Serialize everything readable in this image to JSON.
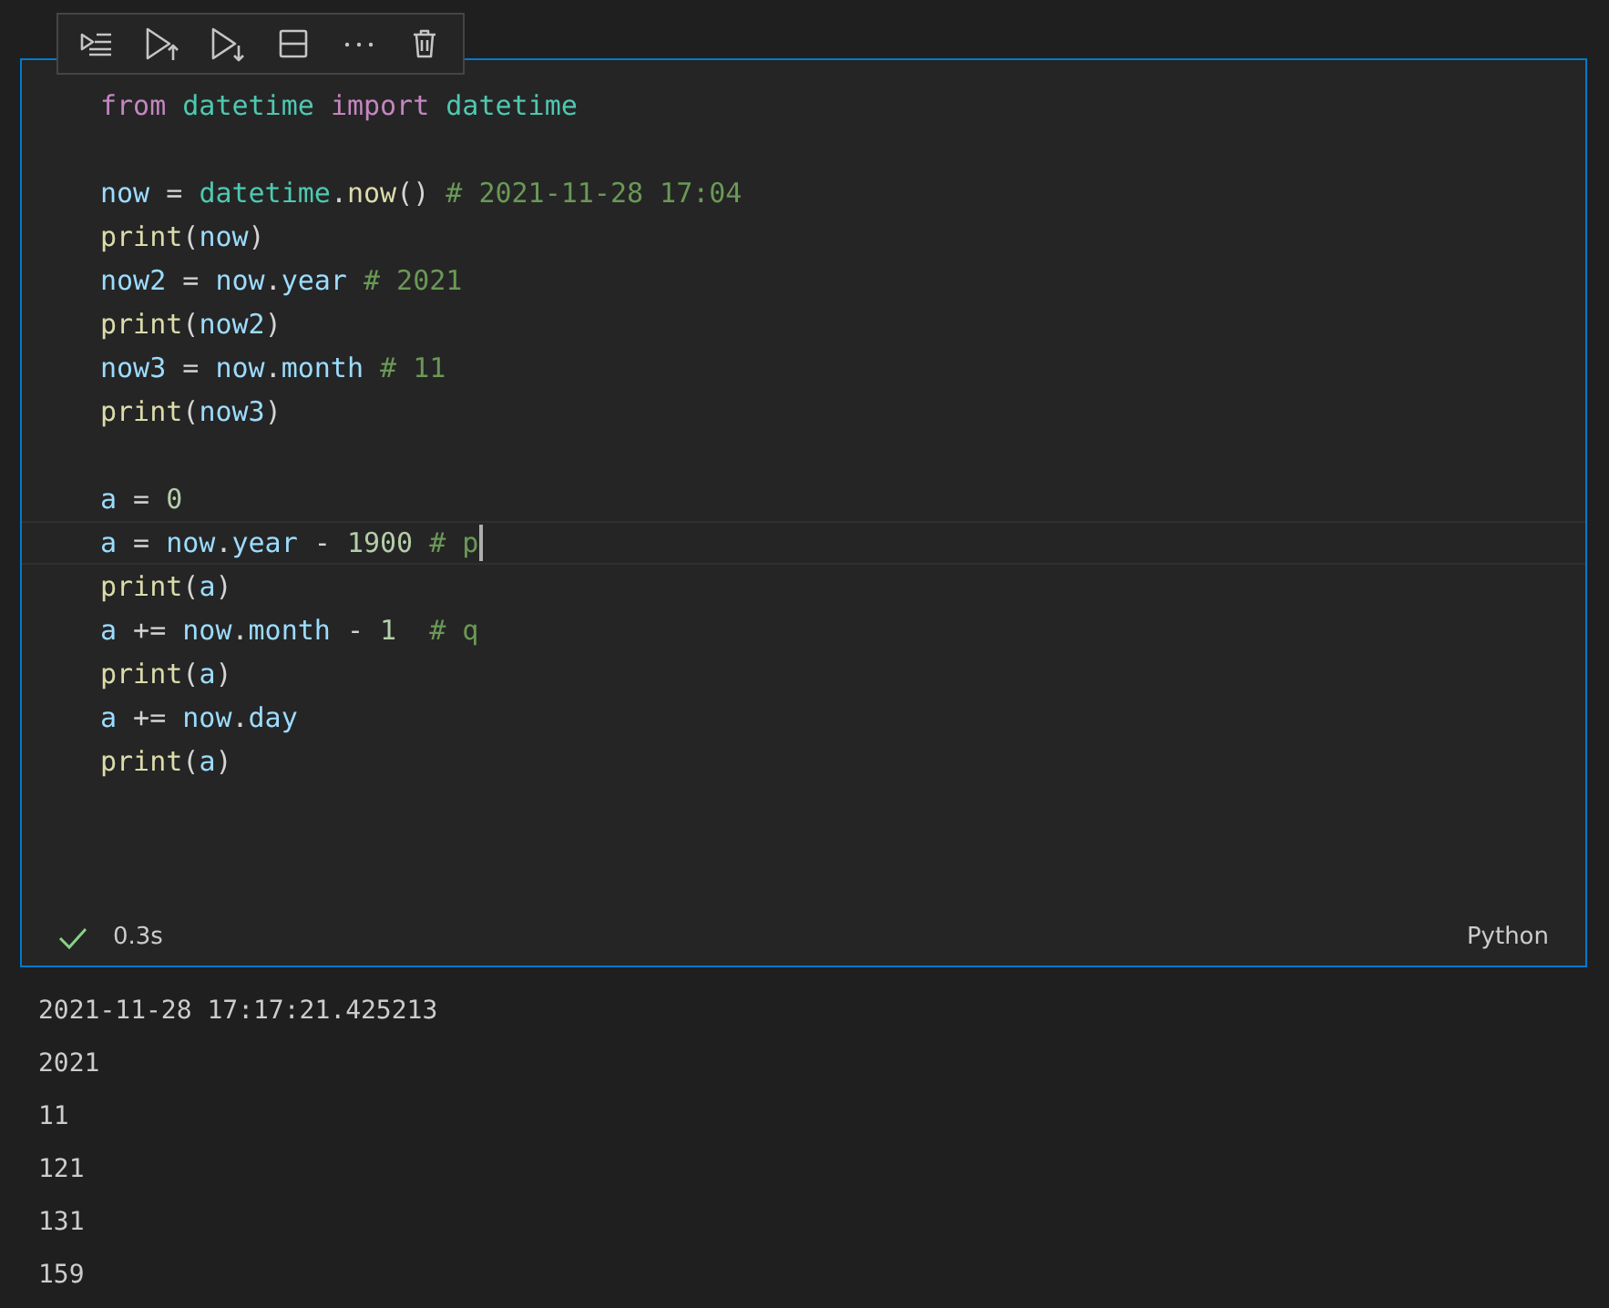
{
  "toolbar": {
    "buttons": [
      {
        "kind": "run-by-line"
      },
      {
        "kind": "run-above"
      },
      {
        "kind": "run-below"
      },
      {
        "kind": "split"
      },
      {
        "kind": "more"
      },
      {
        "kind": "delete"
      }
    ]
  },
  "cell": {
    "lines": [
      {
        "kind": "code",
        "current": false,
        "tokens": [
          {
            "text": "from ",
            "kind": "keyword"
          },
          {
            "text": "datetime ",
            "kind": "class"
          },
          {
            "text": "import ",
            "kind": "keyword"
          },
          {
            "text": "datetime",
            "kind": "class"
          }
        ]
      },
      {
        "kind": "blank"
      },
      {
        "kind": "code",
        "current": false,
        "tokens": [
          {
            "text": "now",
            "kind": "variable"
          },
          {
            "text": " = ",
            "kind": "operator"
          },
          {
            "text": "datetime",
            "kind": "class"
          },
          {
            "text": ".",
            "kind": "operator"
          },
          {
            "text": "now",
            "kind": "function"
          },
          {
            "text": "() ",
            "kind": "operator"
          },
          {
            "text": "# 2021-11-28 17:04",
            "kind": "comment"
          }
        ]
      },
      {
        "kind": "code",
        "current": false,
        "tokens": [
          {
            "text": "print",
            "kind": "function"
          },
          {
            "text": "(",
            "kind": "operator"
          },
          {
            "text": "now",
            "kind": "variable"
          },
          {
            "text": ")",
            "kind": "operator"
          }
        ]
      },
      {
        "kind": "code",
        "current": false,
        "tokens": [
          {
            "text": "now2",
            "kind": "variable"
          },
          {
            "text": " = ",
            "kind": "operator"
          },
          {
            "text": "now",
            "kind": "variable"
          },
          {
            "text": ".",
            "kind": "operator"
          },
          {
            "text": "year ",
            "kind": "variable"
          },
          {
            "text": "# 2021",
            "kind": "comment"
          }
        ]
      },
      {
        "kind": "code",
        "current": false,
        "tokens": [
          {
            "text": "print",
            "kind": "function"
          },
          {
            "text": "(",
            "kind": "operator"
          },
          {
            "text": "now2",
            "kind": "variable"
          },
          {
            "text": ")",
            "kind": "operator"
          }
        ]
      },
      {
        "kind": "code",
        "current": false,
        "tokens": [
          {
            "text": "now3",
            "kind": "variable"
          },
          {
            "text": " = ",
            "kind": "operator"
          },
          {
            "text": "now",
            "kind": "variable"
          },
          {
            "text": ".",
            "kind": "operator"
          },
          {
            "text": "month ",
            "kind": "variable"
          },
          {
            "text": "# 11",
            "kind": "comment"
          }
        ]
      },
      {
        "kind": "code",
        "current": false,
        "tokens": [
          {
            "text": "print",
            "kind": "function"
          },
          {
            "text": "(",
            "kind": "operator"
          },
          {
            "text": "now3",
            "kind": "variable"
          },
          {
            "text": ")",
            "kind": "operator"
          }
        ]
      },
      {
        "kind": "blank"
      },
      {
        "kind": "code",
        "current": false,
        "tokens": [
          {
            "text": "a",
            "kind": "variable"
          },
          {
            "text": " = ",
            "kind": "operator"
          },
          {
            "text": "0",
            "kind": "number"
          }
        ]
      },
      {
        "kind": "code",
        "current": true,
        "tokens": [
          {
            "text": "a",
            "kind": "variable"
          },
          {
            "text": " = ",
            "kind": "operator"
          },
          {
            "text": "now",
            "kind": "variable"
          },
          {
            "text": ".",
            "kind": "operator"
          },
          {
            "text": "year",
            "kind": "variable"
          },
          {
            "text": " - ",
            "kind": "operator"
          },
          {
            "text": "1900 ",
            "kind": "number"
          },
          {
            "text": "# p",
            "kind": "comment"
          }
        ]
      },
      {
        "kind": "code",
        "current": false,
        "tokens": [
          {
            "text": "print",
            "kind": "function"
          },
          {
            "text": "(",
            "kind": "operator"
          },
          {
            "text": "a",
            "kind": "variable"
          },
          {
            "text": ")",
            "kind": "operator"
          }
        ]
      },
      {
        "kind": "code",
        "current": false,
        "tokens": [
          {
            "text": "a",
            "kind": "variable"
          },
          {
            "text": " += ",
            "kind": "operator"
          },
          {
            "text": "now",
            "kind": "variable"
          },
          {
            "text": ".",
            "kind": "operator"
          },
          {
            "text": "month",
            "kind": "variable"
          },
          {
            "text": " - ",
            "kind": "operator"
          },
          {
            "text": "1  ",
            "kind": "number"
          },
          {
            "text": "# q",
            "kind": "comment"
          }
        ]
      },
      {
        "kind": "code",
        "current": false,
        "tokens": [
          {
            "text": "print",
            "kind": "function"
          },
          {
            "text": "(",
            "kind": "operator"
          },
          {
            "text": "a",
            "kind": "variable"
          },
          {
            "text": ")",
            "kind": "operator"
          }
        ]
      },
      {
        "kind": "code",
        "current": false,
        "tokens": [
          {
            "text": "a",
            "kind": "variable"
          },
          {
            "text": " += ",
            "kind": "operator"
          },
          {
            "text": "now",
            "kind": "variable"
          },
          {
            "text": ".",
            "kind": "operator"
          },
          {
            "text": "day",
            "kind": "variable"
          }
        ]
      },
      {
        "kind": "code",
        "current": false,
        "tokens": [
          {
            "text": "print",
            "kind": "function"
          },
          {
            "text": "(",
            "kind": "operator"
          },
          {
            "text": "a",
            "kind": "variable"
          },
          {
            "text": ")",
            "kind": "operator"
          }
        ]
      }
    ],
    "status": {
      "succeeded": true,
      "duration": "0.3s",
      "language": "Python"
    }
  },
  "output": [
    "2021-11-28 17:17:21.425213",
    "2021",
    "11",
    "121",
    "131",
    "159"
  ]
}
